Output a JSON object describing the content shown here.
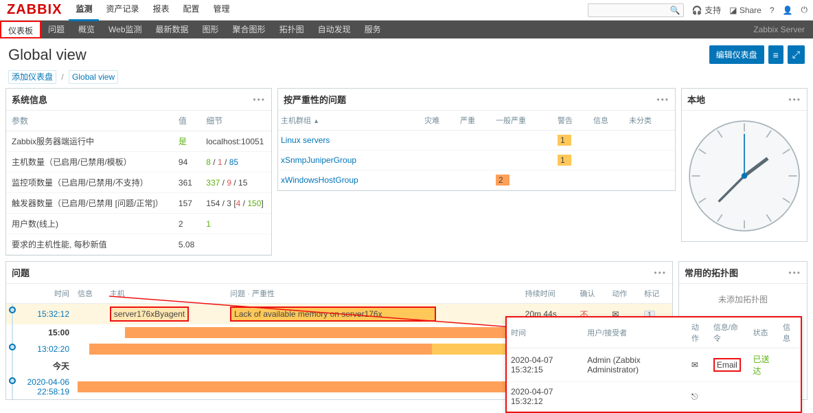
{
  "brand": "ZABBIX",
  "topnav": [
    "监测",
    "资产记录",
    "报表",
    "配置",
    "管理"
  ],
  "toptools": {
    "support": "支持",
    "share": "Share"
  },
  "subnav": [
    "仪表板",
    "问题",
    "概览",
    "Web监测",
    "最新数据",
    "图形",
    "聚合图形",
    "拓扑图",
    "自动发现",
    "服务"
  ],
  "server_label": "Zabbix Server",
  "page_title": "Global view",
  "buttons": {
    "edit": "编辑仪表盘",
    "menu": "≡",
    "fs": "⤢"
  },
  "breadcrumb": {
    "root": "添加仪表盘",
    "leaf": "Global view",
    "sep": "/"
  },
  "sysinfo": {
    "title": "系统信息",
    "headers": [
      "参数",
      "值",
      "细节"
    ],
    "rows": [
      {
        "p": "Zabbix服务器端运行中",
        "v": "是",
        "v_class": "green",
        "d": "localhost:10051"
      },
      {
        "p": "主机数量（已启用/已禁用/模板）",
        "v": "94",
        "d_html": "<span class='green'>8</span> / <span class='red'>1</span> / <span class='blue'>85</span>"
      },
      {
        "p": "监控项数量（已启用/已禁用/不支持）",
        "v": "361",
        "d_html": "<span class='green'>337</span> / <span class='red'>9</span> / <span>15</span>"
      },
      {
        "p": "触发器数量（已启用/已禁用 [问题/正常]）",
        "v": "157",
        "d_html": "154 / 3 [<span class='red'>4</span> / <span class='green'>150</span>]"
      },
      {
        "p": "用户数(线上)",
        "v": "2",
        "d_html": "<span class='green'>1</span>"
      },
      {
        "p": "要求的主机性能, 每秒新值",
        "v": "5.08",
        "d": ""
      }
    ]
  },
  "severity": {
    "title": "按严重性的问题",
    "headers": [
      "主机群组",
      "灾难",
      "严重",
      "一般严重",
      "警告",
      "信息",
      "未分类"
    ],
    "rows": [
      {
        "g": "Linux servers",
        "cells": [
          "",
          "",
          "",
          "1",
          "",
          ""
        ],
        "cls": [
          "",
          "",
          "",
          "warn",
          "",
          ""
        ]
      },
      {
        "g": "xSnmpJuniperGroup",
        "cells": [
          "",
          "",
          "",
          "1",
          "",
          ""
        ],
        "cls": [
          "",
          "",
          "",
          "warn",
          "",
          ""
        ]
      },
      {
        "g": "xWindowsHostGroup",
        "cells": [
          "",
          "",
          "2",
          "",
          "",
          ""
        ],
        "cls": [
          "",
          "",
          "avg",
          "",
          "",
          ""
        ]
      }
    ]
  },
  "local": {
    "title": "本地"
  },
  "problems": {
    "title": "问题",
    "headers": [
      "时间",
      "信息",
      "主机",
      "问题 · 严重性",
      "持续时间",
      "确认",
      "动作",
      "标记"
    ],
    "rows": [
      {
        "time": "15:32:12",
        "time_link": true,
        "host": "server176xByagent",
        "problem": "Lack of available memory on server176x",
        "dur": "20m 44s",
        "ack": "不",
        "actions": "✉",
        "tags": "1",
        "highlight": true
      },
      {
        "time": "15:00",
        "bold": true,
        "bar": [
          [
            "#fff",
            8
          ],
          [
            "#ffa059",
            92
          ]
        ]
      },
      {
        "time": "13:02:20",
        "time_link": true,
        "bar": [
          [
            "#fff",
            2
          ],
          [
            "#ffa059",
            58
          ],
          [
            "#ffc859",
            25
          ],
          [
            "#ffa059",
            15
          ]
        ]
      },
      {
        "time": "今天",
        "bold": true
      },
      {
        "time": "2020-04-06 22:58:19",
        "time_link": true,
        "bar": [
          [
            "#ffa059",
            100
          ]
        ]
      }
    ]
  },
  "topology": {
    "title": "常用的拓扑图",
    "empty": "未添加拓扑图"
  },
  "popup": {
    "headers": [
      "时间",
      "用户/接受者",
      "动作",
      "信息/命令",
      "状态",
      "信息"
    ],
    "rows": [
      {
        "t": "2020-04-07 15:32:15",
        "u": "Admin (Zabbix Administrator)",
        "a": "✉",
        "cmd": "Email",
        "st": "已送达"
      },
      {
        "t": "2020-04-07 15:32:12",
        "u": "",
        "a": "⎋",
        "cmd": "",
        "st": ""
      }
    ]
  }
}
